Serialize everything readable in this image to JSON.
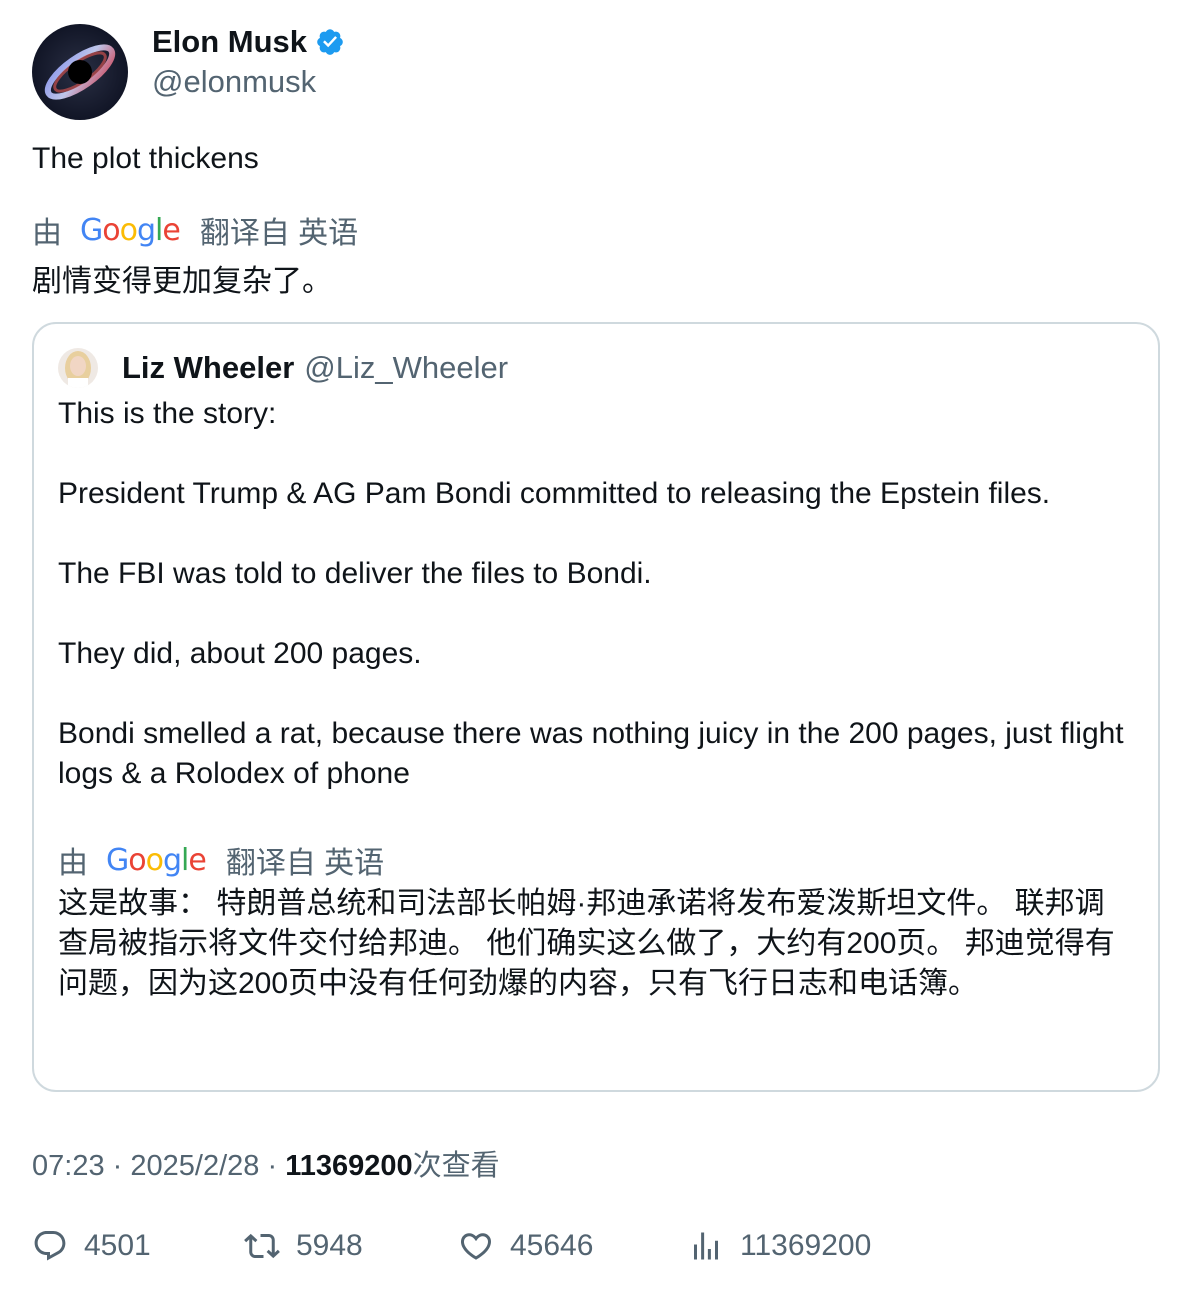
{
  "author": {
    "display_name": "Elon Musk",
    "handle": "@elonmusk",
    "verified_icon": "verified-badge-icon"
  },
  "tweet": {
    "text": "The plot thickens",
    "translation": {
      "by_label": "由",
      "provider": "Google",
      "from_label": "翻译自 英语",
      "text": "剧情变得更加复杂了。"
    }
  },
  "quote": {
    "display_name": "Liz Wheeler",
    "handle": "@Liz_Wheeler",
    "paragraphs": [
      "This is the story:",
      "President Trump & AG Pam Bondi committed to releasing the Epstein files.",
      "The FBI was told to deliver the files to Bondi.",
      "They did, about 200 pages.",
      "Bondi smelled a rat, because there was nothing juicy in the 200 pages, just flight logs & a Rolodex of phone"
    ],
    "translation": {
      "by_label": "由",
      "provider": "Google",
      "from_label": "翻译自 英语",
      "text": "这是故事： 特朗普总统和司法部长帕姆·邦迪承诺将发布爱泼斯坦文件。 联邦调查局被指示将文件交付给邦迪。 他们确实这么做了，大约有200页。 邦迪觉得有问题，因为这200页中没有任何劲爆的内容，只有飞行日志和电话簿。"
    }
  },
  "meta": {
    "time": "07:23",
    "separator": "·",
    "date": "2025/2/28",
    "views_count": "11369200",
    "views_label": "次查看"
  },
  "actions": {
    "replies": "4501",
    "retweets": "5948",
    "likes": "45646",
    "views": "11369200"
  },
  "colors": {
    "text_primary": "#0f1419",
    "text_secondary": "#536471",
    "verified": "#1d9bf0",
    "border": "#cfd9de"
  }
}
